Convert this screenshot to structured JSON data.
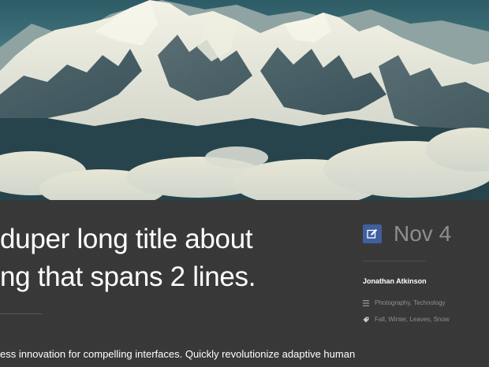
{
  "post": {
    "title_line1": "duper long title about",
    "title_line2": "ng that spans 2 lines.",
    "excerpt": "ess innovation for compelling interfaces. Quickly revolutionize adaptive human"
  },
  "meta": {
    "date_icon": "edit-icon",
    "date": "Nov 4",
    "author": "Jonathan Atkinson",
    "categories_icon": "list-icon",
    "categories": "Photography, Technology",
    "tags_icon": "tag-icon",
    "tags": "Fall, Winter, Leaves, Snow"
  },
  "colors": {
    "background": "#373737",
    "accent": "#3f5f9e",
    "date_text": "#8e8e8e",
    "meta_text": "#8f8f8f"
  }
}
